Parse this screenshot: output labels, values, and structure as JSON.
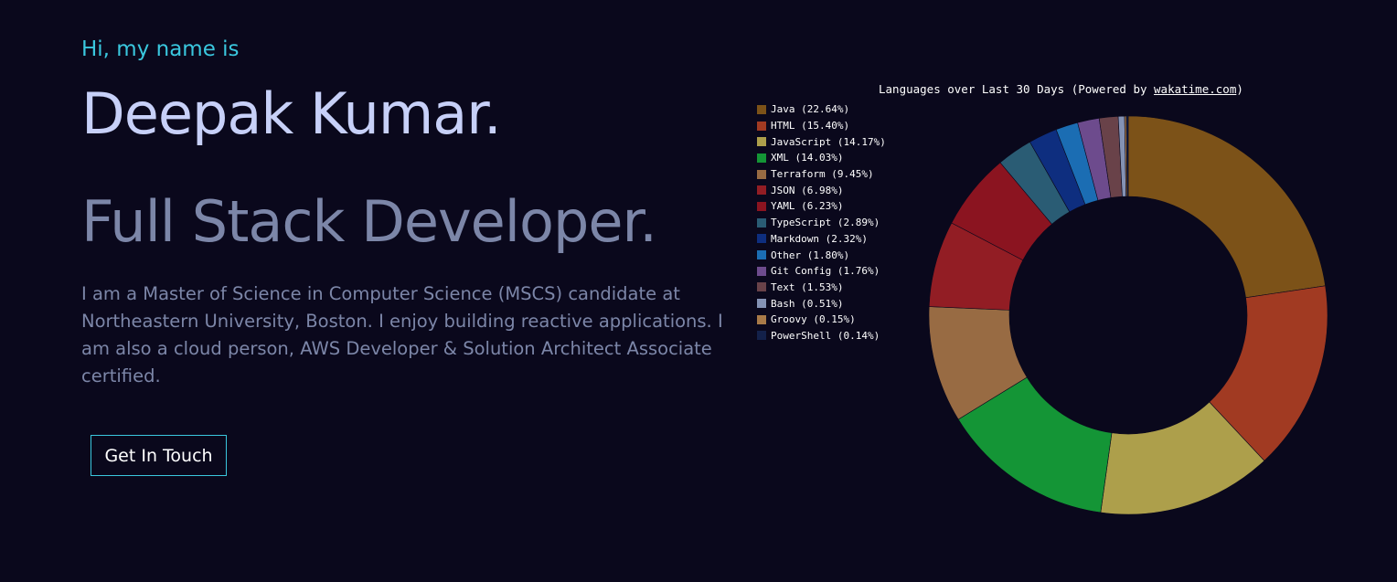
{
  "hero": {
    "greeting": "Hi, my name is",
    "name": "Deepak Kumar.",
    "role": "Full Stack Developer.",
    "bio": "I am a Master of Science in Computer Science (MSCS) candidate at Northeastern University, Boston. I enjoy building reactive applications. I am also a cloud person, AWS Developer & Solution Architect Associate certified.",
    "cta_label": "Get In Touch"
  },
  "colors": {
    "background": "#0a081c",
    "accent": "#3ac7de",
    "name": "#c7d0f8",
    "muted": "#7c86a8"
  },
  "chart_data": {
    "type": "pie",
    "variant": "donut",
    "title_prefix": "Languages over Last 30 Days (Powered by ",
    "title_link": "wakatime.com",
    "title_suffix": ")",
    "legend_placement": "left",
    "series": [
      {
        "name": "Java",
        "label": "Java (22.64%)",
        "value": 22.64,
        "color": "#7c5218"
      },
      {
        "name": "HTML",
        "label": "HTML (15.40%)",
        "value": 15.4,
        "color": "#a13a22"
      },
      {
        "name": "JavaScript",
        "label": "JavaScript (14.17%)",
        "value": 14.17,
        "color": "#ad9f4b"
      },
      {
        "name": "XML",
        "label": "XML (14.03%)",
        "value": 14.03,
        "color": "#149536"
      },
      {
        "name": "Terraform",
        "label": "Terraform (9.45%)",
        "value": 9.45,
        "color": "#986b43"
      },
      {
        "name": "JSON",
        "label": "JSON (6.98%)",
        "value": 6.98,
        "color": "#921d24"
      },
      {
        "name": "YAML",
        "label": "YAML (6.23%)",
        "value": 6.23,
        "color": "#8b1420"
      },
      {
        "name": "TypeScript",
        "label": "TypeScript (2.89%)",
        "value": 2.89,
        "color": "#2a5c74"
      },
      {
        "name": "Markdown",
        "label": "Markdown (2.32%)",
        "value": 2.32,
        "color": "#0e2e7f"
      },
      {
        "name": "Other",
        "label": "Other (1.80%)",
        "value": 1.8,
        "color": "#1b6db3"
      },
      {
        "name": "Git Config",
        "label": "Git Config (1.76%)",
        "value": 1.76,
        "color": "#6d4b8d"
      },
      {
        "name": "Text",
        "label": "Text (1.53%)",
        "value": 1.53,
        "color": "#694249"
      },
      {
        "name": "Bash",
        "label": "Bash (0.51%)",
        "value": 0.51,
        "color": "#8492b4"
      },
      {
        "name": "Groovy",
        "label": "Groovy (0.15%)",
        "value": 0.15,
        "color": "#a87a48"
      },
      {
        "name": "PowerShell",
        "label": "PowerShell (0.14%)",
        "value": 0.14,
        "color": "#13214a"
      }
    ]
  }
}
